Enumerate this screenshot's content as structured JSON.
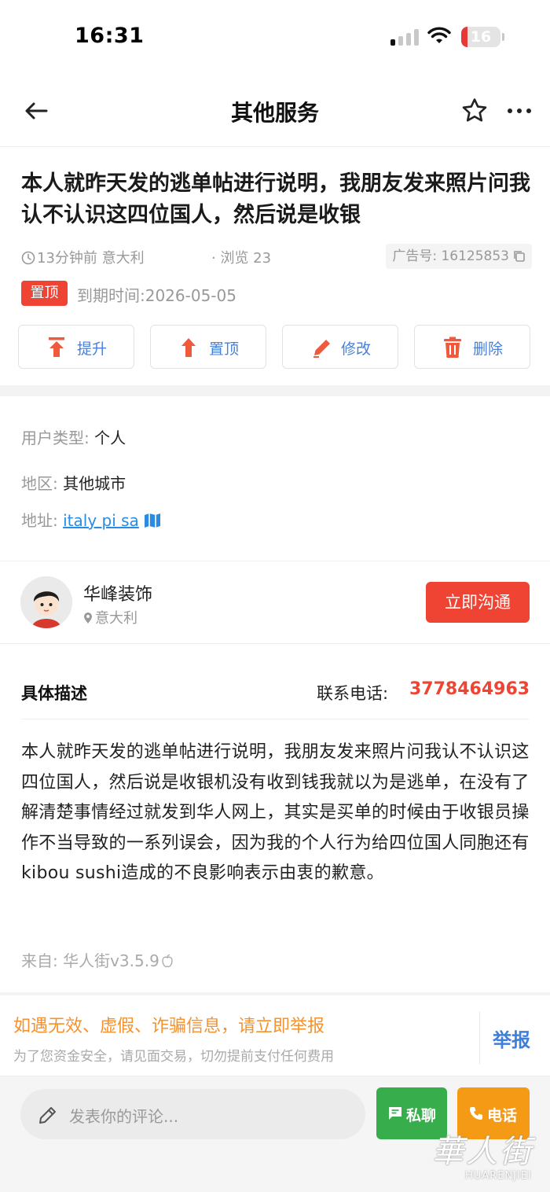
{
  "status_bar": {
    "time": "16:31",
    "battery_level": "16",
    "battery_fraction": 0.16
  },
  "nav": {
    "title": "其他服务"
  },
  "post": {
    "title": "本人就昨天发的逃单帖进行说明，我朋友发来照片问我认不认识这四位国人，然后说是收银",
    "time": "13分钟前",
    "location": "意大利",
    "views": "· 浏览 23",
    "ad_number": "广告号: 16125853",
    "top_badge": "置顶",
    "expire": "到期时间:2026-05-05"
  },
  "actions": [
    {
      "label": "提升",
      "icon": "raise-icon"
    },
    {
      "label": "置顶",
      "icon": "pin-top-icon"
    },
    {
      "label": "修改",
      "icon": "edit-icon"
    },
    {
      "label": "删除",
      "icon": "trash-icon"
    }
  ],
  "info": {
    "user_type_label": "用户类型: ",
    "user_type_value": "个人",
    "region_label": "地区: ",
    "region_value": "其他城市",
    "address_label": "地址: ",
    "address_value": "italy pi sa"
  },
  "seller": {
    "name": "华峰装饰",
    "location": "意大利",
    "chat_button": "立即沟通"
  },
  "description": {
    "heading": "具体描述",
    "phone_label": "联系电话:",
    "phone": "3778464963",
    "body": "本人就昨天发的逃单帖进行说明，我朋友发来照片问我认不认识这四位国人，然后说是收银机没有收到钱我就以为是逃单，在没有了解清楚事情经过就发到华人网上，其实是买单的时候由于收银员操作不当导致的一系列误会，因为我的个人行为给四位国人同胞还有kibou sushi造成的不良影响表示由衷的歉意。",
    "source": "来自: 华人街v3.5.9"
  },
  "warning": {
    "title": "如遇无效、虚假、诈骗信息，请立即举报",
    "subtitle": "为了您资金安全，请见面交易，切勿提前支付任何费用",
    "report_button": "举报"
  },
  "bottom_bar": {
    "comment_placeholder": "发表你的评论...",
    "message_button": "私聊",
    "call_button": "电话"
  },
  "watermark": {
    "main": "華人街",
    "sub": "HUARENJIEI"
  },
  "colors": {
    "accent_red": "#ef4433",
    "link_blue": "#2b8be0",
    "button_blue": "#4a7fd6",
    "warning_orange": "#f5922f",
    "green": "#38ad4c",
    "orange": "#f59a14"
  }
}
